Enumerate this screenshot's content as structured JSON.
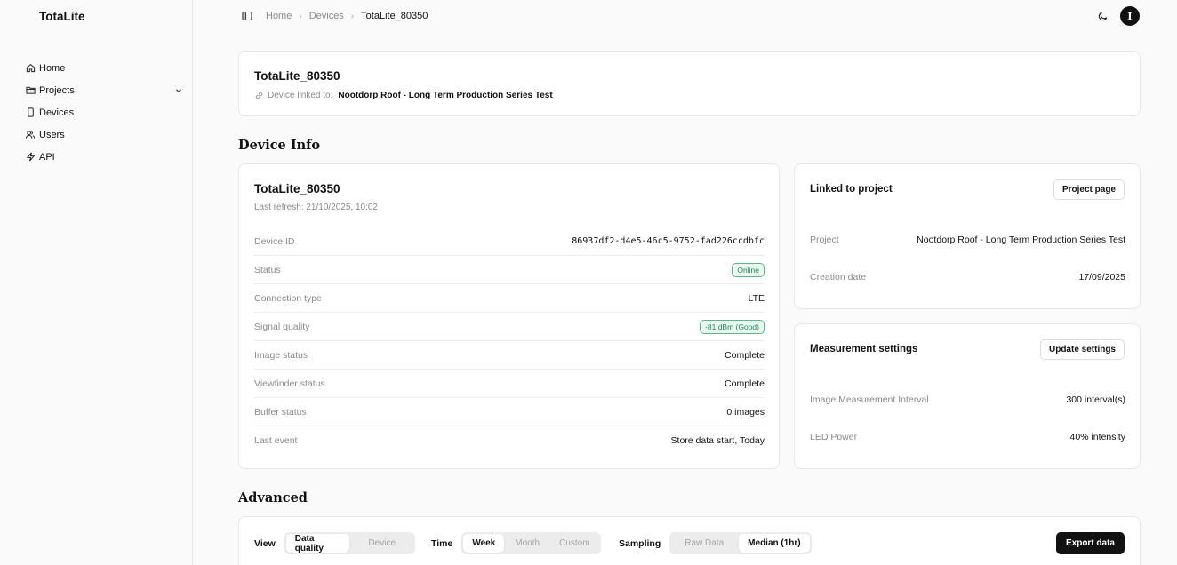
{
  "app": {
    "name": "TotaLite"
  },
  "sidebar": {
    "items": [
      {
        "label": "Home",
        "icon": "home-icon"
      },
      {
        "label": "Projects",
        "icon": "folder-icon"
      },
      {
        "label": "Devices",
        "icon": "device-icon"
      },
      {
        "label": "Users",
        "icon": "users-icon"
      },
      {
        "label": "API",
        "icon": "bolt-icon"
      }
    ]
  },
  "breadcrumb": {
    "home": "Home",
    "devices": "Devices",
    "current": "TotaLite_80350"
  },
  "user": {
    "initial": "I"
  },
  "header": {
    "title": "TotaLite_80350",
    "linked_label": "Device linked to:",
    "linked_project": "Nootdorp Roof - Long Term Production Series Test"
  },
  "device_info": {
    "section_title": "Device Info",
    "name": "TotaLite_80350",
    "last_refresh": "Last refresh: 21/10/2025, 10:02",
    "rows": [
      {
        "key": "Device ID",
        "value": "86937df2-d4e5-46c5-9752-fad226ccdbfc"
      },
      {
        "key": "Status",
        "value": "Online"
      },
      {
        "key": "Connection type",
        "value": "LTE"
      },
      {
        "key": "Signal quality",
        "value": "-81 dBm (Good)"
      },
      {
        "key": "Image status",
        "value": "Complete"
      },
      {
        "key": "Viewfinder status",
        "value": "Complete"
      },
      {
        "key": "Buffer status",
        "value": "0 images"
      },
      {
        "key": "Last event",
        "value": "Store data start, Today"
      }
    ],
    "status_color": "#1f8a55"
  },
  "linked_project": {
    "title": "Linked to project",
    "button": "Project page",
    "project_label": "Project",
    "project_value": "Nootdorp Roof - Long Term Production Series Test",
    "created_label": "Creation date",
    "created_value": "17/09/2025"
  },
  "measurement": {
    "title": "Measurement settings",
    "button": "Update settings",
    "interval_label": "Image Measurement Interval",
    "interval_value": "300 interval(s)",
    "led_label": "LED Power",
    "led_value": "40% intensity"
  },
  "advanced": {
    "section_title": "Advanced",
    "view_label": "View",
    "view_options": [
      "Data quality",
      "Device"
    ],
    "view_selected": "Data quality",
    "time_label": "Time",
    "time_options": [
      "Week",
      "Month",
      "Custom"
    ],
    "time_selected": "Week",
    "sampling_label": "Sampling",
    "sampling_options": [
      "Raw Data",
      "Median (1hr)"
    ],
    "sampling_selected": "Median (1hr)",
    "export_button": "Export data"
  }
}
